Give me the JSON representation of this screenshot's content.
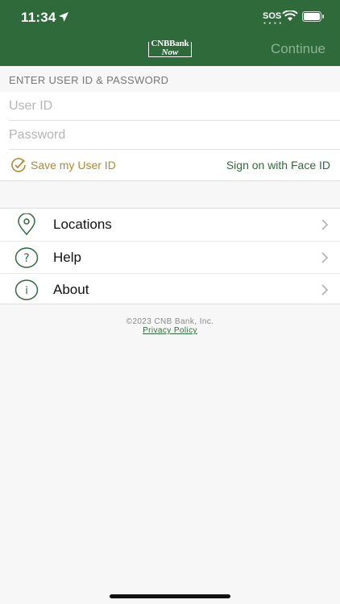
{
  "status_bar": {
    "time": "11:34",
    "sos": "SOS"
  },
  "header": {
    "logo_top": "CNBBank",
    "logo_bottom": "Now",
    "continue_label": "Continue"
  },
  "login": {
    "section_label": "ENTER USER ID & PASSWORD",
    "user_id_placeholder": "User ID",
    "password_placeholder": "Password",
    "save_user_id_label": "Save my User ID",
    "face_id_label": "Sign on with Face ID"
  },
  "menu": {
    "items": [
      {
        "label": "Locations",
        "icon": "location-pin-icon"
      },
      {
        "label": "Help",
        "icon": "question-icon"
      },
      {
        "label": "About",
        "icon": "info-icon"
      }
    ]
  },
  "footer": {
    "copyright": "©2023 CNB Bank, Inc.",
    "privacy_link": "Privacy Policy"
  },
  "colors": {
    "brand_green": "#2f6a3a",
    "gold": "#b08a2c"
  }
}
